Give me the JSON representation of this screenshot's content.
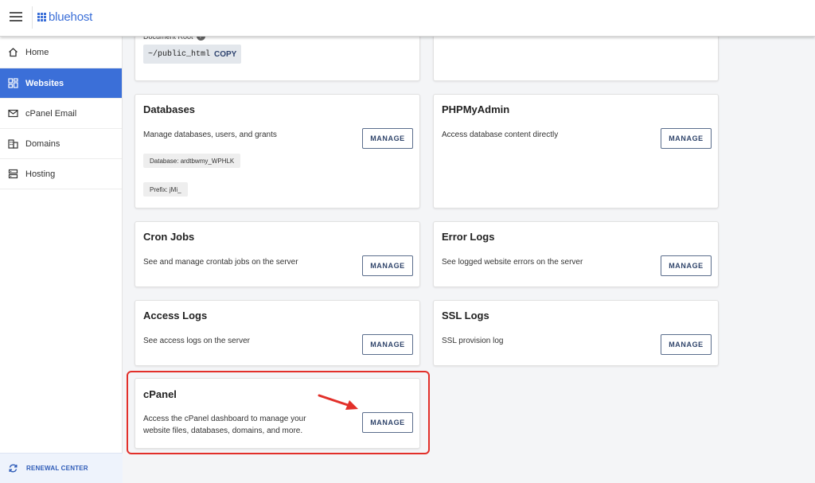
{
  "brand": {
    "name": "bluehost"
  },
  "sidebar": {
    "items": [
      {
        "label": "Home",
        "icon": "home-icon",
        "active": false
      },
      {
        "label": "Websites",
        "icon": "websites-icon",
        "active": true
      },
      {
        "label": "cPanel Email",
        "icon": "email-icon",
        "active": false
      },
      {
        "label": "Domains",
        "icon": "domains-icon",
        "active": false
      },
      {
        "label": "Hosting",
        "icon": "hosting-icon",
        "active": false
      }
    ],
    "renewal": {
      "label": "RENEWAL CENTER",
      "icon": "renewal-icon"
    }
  },
  "docroot": {
    "label": "Document Root",
    "path": "~/public_html",
    "copy_label": "COPY"
  },
  "cards": {
    "databases": {
      "title": "Databases",
      "desc": "Manage databases, users, and grants",
      "button": "MANAGE",
      "database_tag": "Database: ardtbwmy_WPHLK",
      "prefix_tag": "Prefix: jMi_"
    },
    "phpmyadmin": {
      "title": "PHPMyAdmin",
      "desc": "Access database content directly",
      "button": "MANAGE"
    },
    "cron": {
      "title": "Cron Jobs",
      "desc": "See and manage crontab jobs on the server",
      "button": "MANAGE"
    },
    "errorlogs": {
      "title": "Error Logs",
      "desc": "See logged website errors on the server",
      "button": "MANAGE"
    },
    "accesslogs": {
      "title": "Access Logs",
      "desc": "See access logs on the server",
      "button": "MANAGE"
    },
    "ssllogs": {
      "title": "SSL Logs",
      "desc": "SSL provision log",
      "button": "MANAGE"
    },
    "cpanel": {
      "title": "cPanel",
      "desc_line1": "Access the cPanel dashboard to manage your",
      "desc_line2": "website files, databases, domains, and more.",
      "button": "MANAGE"
    }
  },
  "colors": {
    "accent": "#3b6fd8",
    "highlight": "#e2302a",
    "button_text": "#30456b"
  }
}
